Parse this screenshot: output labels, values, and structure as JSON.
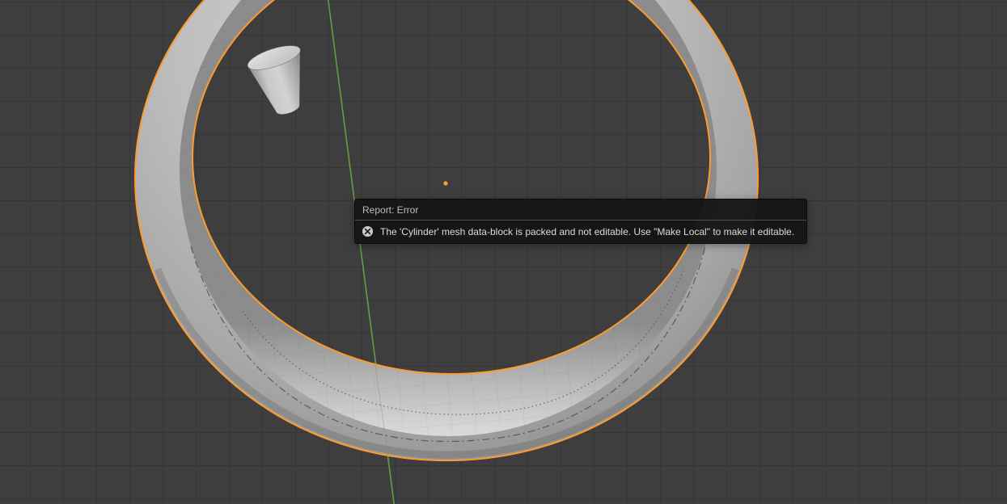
{
  "viewport": {
    "background_color": "#3e3e3e",
    "grid_line_color": "#363636",
    "y_axis_color": "#69a23e",
    "selection_outline_color": "#ff9b2d",
    "origin_dot_color": "#ffa028",
    "objects": [
      "torus",
      "cylinder"
    ]
  },
  "report": {
    "title": "Report: Error",
    "icon": "error-circle-x-icon",
    "message": "The 'Cylinder' mesh data-block is packed and not editable. Use \"Make Local\" to make it editable."
  }
}
